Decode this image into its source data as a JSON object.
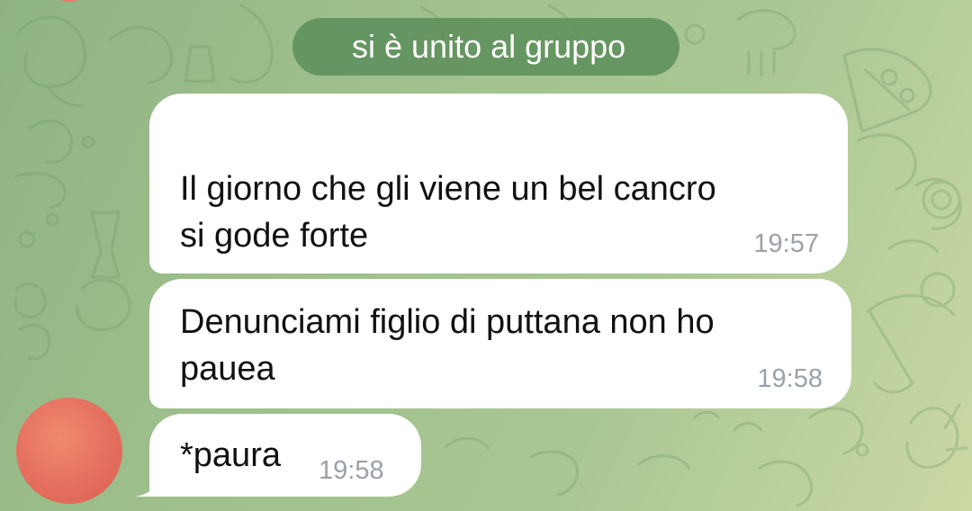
{
  "theme": {
    "chat_background": "#a4c28d",
    "bubble_color": "#ffffff",
    "service_pill_color": "#5c8e5b",
    "time_color": "#9aa1a8",
    "avatar_color": "#e46f5f"
  },
  "chat": {
    "service_message": "si è unito al gruppo",
    "messages": [
      {
        "text": "Il giorno che gli viene un bel cancro\nsi gode forte",
        "time": "19:57"
      },
      {
        "text": "Denunciami figlio di puttana non ho\npauea",
        "time": "19:58"
      },
      {
        "text": "*paura",
        "time": "19:58"
      }
    ]
  }
}
